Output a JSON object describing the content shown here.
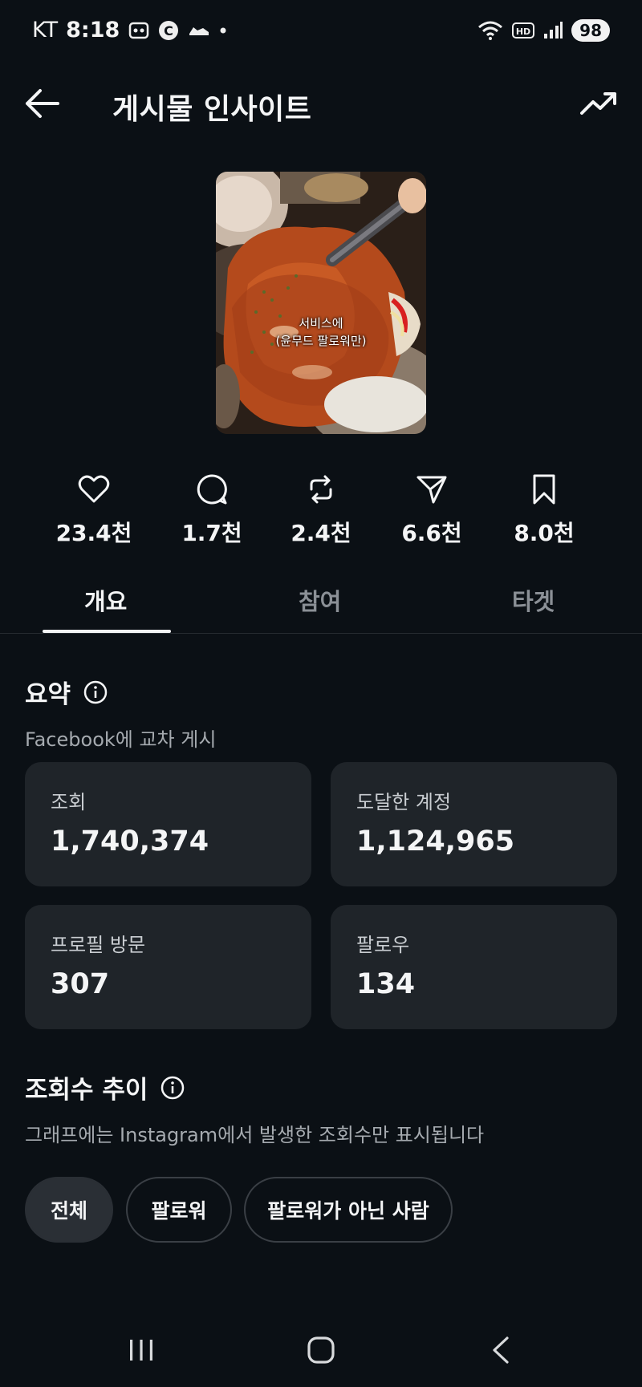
{
  "status": {
    "carrier": "KT",
    "time": "8:18",
    "battery": "98",
    "network_badge": "HD"
  },
  "header": {
    "title": "게시물 인사이트"
  },
  "thumbnail": {
    "caption_line1": "서비스에",
    "caption_line2": "(윤무드 팔로워만)"
  },
  "stats": [
    {
      "icon": "heart-icon",
      "value": "23.4천"
    },
    {
      "icon": "comment-icon",
      "value": "1.7천"
    },
    {
      "icon": "repost-icon",
      "value": "2.4천"
    },
    {
      "icon": "share-icon",
      "value": "6.6천"
    },
    {
      "icon": "bookmark-icon",
      "value": "8.0천"
    }
  ],
  "tabs": [
    {
      "label": "개요",
      "active": true
    },
    {
      "label": "참여",
      "active": false
    },
    {
      "label": "타겟",
      "active": false
    }
  ],
  "summary": {
    "title": "요약",
    "subtitle": "Facebook에 교차 게시",
    "cards": [
      {
        "label": "조회",
        "value": "1,740,374"
      },
      {
        "label": "도달한 계정",
        "value": "1,124,965"
      },
      {
        "label": "프로필 방문",
        "value": "307"
      },
      {
        "label": "팔로우",
        "value": "134"
      }
    ]
  },
  "views_trend": {
    "title": "조회수 추이",
    "subtitle": "그래프에는 Instagram에서 발생한 조회수만 표시됩니다",
    "filters": [
      {
        "label": "전체",
        "active": true
      },
      {
        "label": "팔로워",
        "active": false
      },
      {
        "label": "팔로워가 아닌 사람",
        "active": false
      }
    ]
  },
  "colors": {
    "background": "#0b1015",
    "card": "#1f2429",
    "text_primary": "#f4f5f6",
    "text_secondary": "#a5aaaf"
  }
}
